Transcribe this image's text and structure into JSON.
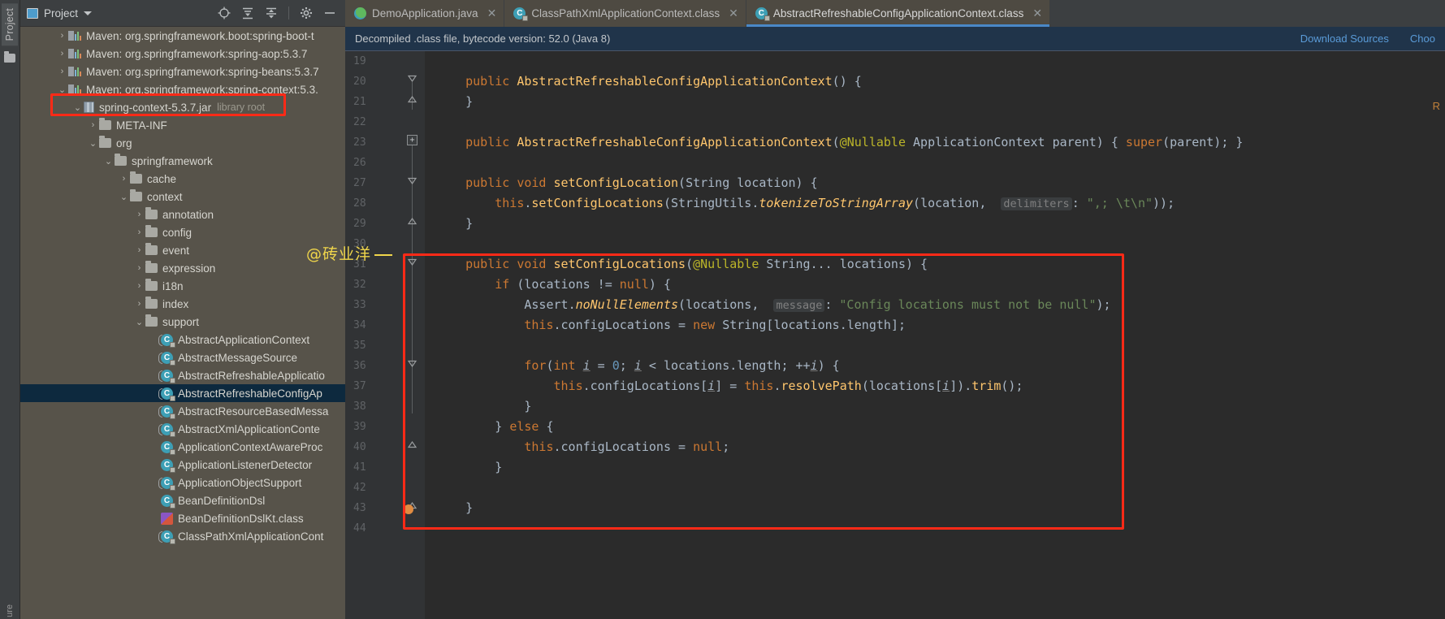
{
  "window": {
    "left_strip": {
      "project_tab": "Project",
      "bottom_tab": "ure",
      "folder_icon": "folder-icon"
    }
  },
  "project_panel": {
    "title": "Project",
    "title_icon": "project-icon",
    "dropdown_icon": "chevron-down-icon",
    "actions": [
      {
        "name": "locate-icon",
        "glyph": "⊕"
      },
      {
        "name": "expand-all-icon",
        "glyph": "⇟"
      },
      {
        "name": "collapse-all-icon",
        "glyph": "⇡"
      },
      {
        "name": "settings-gear-icon",
        "glyph": "⚙"
      },
      {
        "name": "hide-panel-icon",
        "glyph": "—"
      }
    ],
    "tree": [
      {
        "indent": 2,
        "chev": "›",
        "icon": "maven-icon",
        "label": "Maven: org.springframework.boot:spring-boot-t",
        "selected": false
      },
      {
        "indent": 2,
        "chev": "›",
        "icon": "maven-icon",
        "label": "Maven: org.springframework:spring-aop:5.3.7",
        "selected": false
      },
      {
        "indent": 2,
        "chev": "›",
        "icon": "maven-icon",
        "label": "Maven: org.springframework:spring-beans:5.3.7",
        "selected": false
      },
      {
        "indent": 2,
        "chev": "⌄",
        "icon": "maven-icon",
        "label": "Maven: org.springframework:spring-context:5.3.",
        "selected": false
      },
      {
        "indent": 3,
        "chev": "⌄",
        "icon": "jar-icon",
        "label": "spring-context-5.3.7.jar",
        "sub": "library root",
        "selected": false
      },
      {
        "indent": 4,
        "chev": "›",
        "icon": "folder-icon",
        "label": "META-INF",
        "selected": false
      },
      {
        "indent": 4,
        "chev": "⌄",
        "icon": "folder-icon",
        "label": "org",
        "selected": false
      },
      {
        "indent": 5,
        "chev": "⌄",
        "icon": "folder-icon",
        "label": "springframework",
        "selected": false
      },
      {
        "indent": 6,
        "chev": "›",
        "icon": "folder-icon",
        "label": "cache",
        "selected": false
      },
      {
        "indent": 6,
        "chev": "⌄",
        "icon": "folder-icon",
        "label": "context",
        "selected": false
      },
      {
        "indent": 7,
        "chev": "›",
        "icon": "folder-icon",
        "label": "annotation",
        "selected": false
      },
      {
        "indent": 7,
        "chev": "›",
        "icon": "folder-icon",
        "label": "config",
        "selected": false
      },
      {
        "indent": 7,
        "chev": "›",
        "icon": "folder-icon",
        "label": "event",
        "selected": false
      },
      {
        "indent": 7,
        "chev": "›",
        "icon": "folder-icon",
        "label": "expression",
        "selected": false
      },
      {
        "indent": 7,
        "chev": "›",
        "icon": "folder-icon",
        "label": "i18n",
        "selected": false
      },
      {
        "indent": 7,
        "chev": "›",
        "icon": "folder-icon",
        "label": "index",
        "selected": false
      },
      {
        "indent": 7,
        "chev": "⌄",
        "icon": "folder-icon",
        "label": "support",
        "selected": false
      },
      {
        "indent": 8,
        "chev": "",
        "icon": "abstract-class-icon",
        "label": "AbstractApplicationContext",
        "selected": false
      },
      {
        "indent": 8,
        "chev": "",
        "icon": "abstract-class-icon",
        "label": "AbstractMessageSource",
        "selected": false
      },
      {
        "indent": 8,
        "chev": "",
        "icon": "abstract-class-icon",
        "label": "AbstractRefreshableApplicatio",
        "selected": false
      },
      {
        "indent": 8,
        "chev": "",
        "icon": "abstract-class-icon",
        "label": "AbstractRefreshableConfigAp",
        "selected": true
      },
      {
        "indent": 8,
        "chev": "",
        "icon": "abstract-class-icon",
        "label": "AbstractResourceBasedMessa",
        "selected": false
      },
      {
        "indent": 8,
        "chev": "",
        "icon": "abstract-class-icon",
        "label": "AbstractXmlApplicationConte",
        "selected": false
      },
      {
        "indent": 8,
        "chev": "",
        "icon": "class-icon",
        "label": "ApplicationContextAwareProc",
        "selected": false
      },
      {
        "indent": 8,
        "chev": "",
        "icon": "class-icon",
        "label": "ApplicationListenerDetector",
        "selected": false
      },
      {
        "indent": 8,
        "chev": "",
        "icon": "abstract-class-icon",
        "label": "ApplicationObjectSupport",
        "selected": false
      },
      {
        "indent": 8,
        "chev": "",
        "icon": "class-icon",
        "label": "BeanDefinitionDsl",
        "selected": false
      },
      {
        "indent": 8,
        "chev": "",
        "icon": "kotlin-class-icon",
        "label": "BeanDefinitionDslKt.class",
        "selected": false
      },
      {
        "indent": 8,
        "chev": "",
        "icon": "abstract-class-icon",
        "label": "ClassPathXmlApplicationCont",
        "selected": false
      }
    ]
  },
  "editor": {
    "tabs": [
      {
        "label": "DemoApplication.java",
        "icon": "java-run-class-icon",
        "active": false,
        "closable": true
      },
      {
        "label": "ClassPathXmlApplicationContext.class",
        "icon": "decompiled-class-icon",
        "active": false,
        "closable": true
      },
      {
        "label": "AbstractRefreshableConfigApplicationContext.class",
        "icon": "decompiled-class-icon",
        "active": true,
        "closable": true
      }
    ],
    "notification": {
      "message": "Decompiled .class file, bytecode version: 52.0 (Java 8)",
      "actions": [
        "Download Sources",
        "Choo"
      ]
    },
    "right_marker": "R",
    "line_numbers": [
      "19",
      "20",
      "21",
      "22",
      "23",
      "26",
      "27",
      "28",
      "29",
      "30",
      "31",
      "32",
      "33",
      "34",
      "35",
      "36",
      "37",
      "38",
      "39",
      "40",
      "41",
      "42",
      "43",
      "44"
    ],
    "code_lines": [
      {
        "n": "19",
        "text": ""
      },
      {
        "n": "20",
        "text": "    public AbstractRefreshableConfigApplicationContext() {"
      },
      {
        "n": "21",
        "text": "    }"
      },
      {
        "n": "22",
        "text": ""
      },
      {
        "n": "23",
        "text": "    public AbstractRefreshableConfigApplicationContext(@Nullable ApplicationContext parent) { super(parent); }"
      },
      {
        "n": "26",
        "text": ""
      },
      {
        "n": "27",
        "text": "    public void setConfigLocation(String location) {"
      },
      {
        "n": "28",
        "text": "        this.setConfigLocations(StringUtils.tokenizeToStringArray(location,  delimiters: \",; \\t\\n\"));"
      },
      {
        "n": "29",
        "text": "    }"
      },
      {
        "n": "30",
        "text": ""
      },
      {
        "n": "31",
        "text": "    public void setConfigLocations(@Nullable String... locations) {"
      },
      {
        "n": "32",
        "text": "        if (locations != null) {"
      },
      {
        "n": "33",
        "text": "            Assert.noNullElements(locations,  message: \"Config locations must not be null\");"
      },
      {
        "n": "34",
        "text": "            this.configLocations = new String[locations.length];"
      },
      {
        "n": "35",
        "text": ""
      },
      {
        "n": "36",
        "text": "            for(int i = 0; i < locations.length; ++i) {"
      },
      {
        "n": "37",
        "text": "                this.configLocations[i] = this.resolvePath(locations[i]).trim();"
      },
      {
        "n": "38",
        "text": "            }"
      },
      {
        "n": "39",
        "text": "        } else {"
      },
      {
        "n": "40",
        "text": "            this.configLocations = null;"
      },
      {
        "n": "41",
        "text": "        }"
      },
      {
        "n": "42",
        "text": ""
      },
      {
        "n": "43",
        "text": "    }"
      },
      {
        "n": "44",
        "text": ""
      }
    ],
    "inlay_hints": {
      "delimiters": "delimiters:",
      "message": "message:"
    }
  },
  "annotations": {
    "watermark_text": "@砖业洋",
    "box_color": "#ff2a17",
    "highlight_color": "#f0d64b"
  }
}
